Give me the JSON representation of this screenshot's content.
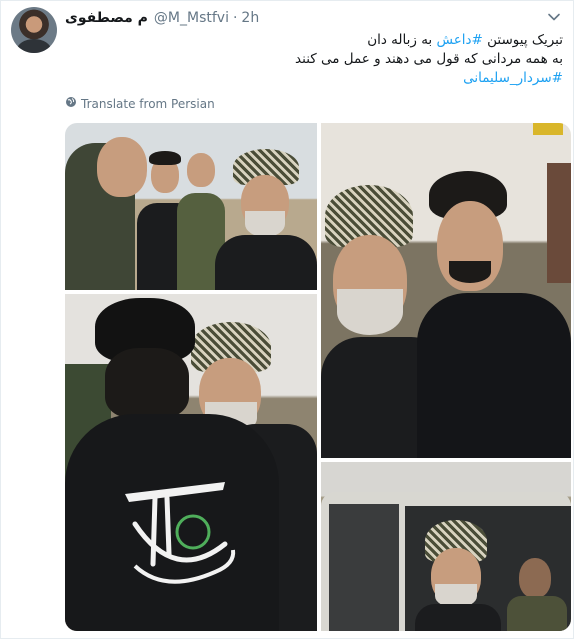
{
  "tweet": {
    "full_name": "م مصطفوی",
    "screen_name": "@M_Mstfvi",
    "separator": "·",
    "time": "2h",
    "text": {
      "line1_prefix": "تبریک پیوستن ",
      "line1_hashtag": "#داعش",
      "line1_suffix": " به زباله دان",
      "line2": "به همه مردانی که قول می دهند و عمل می کنند",
      "line3_hashtag": "#سردار_سلیمانی"
    },
    "translate_label": "Translate from Persian"
  },
  "media": {
    "photo_count": 4
  },
  "icons": {
    "chevron": "chevron-down-icon",
    "globe": "globe-icon"
  },
  "colors": {
    "link": "#1da1f2",
    "secondary_text": "#657786",
    "primary_text": "#14171a"
  }
}
